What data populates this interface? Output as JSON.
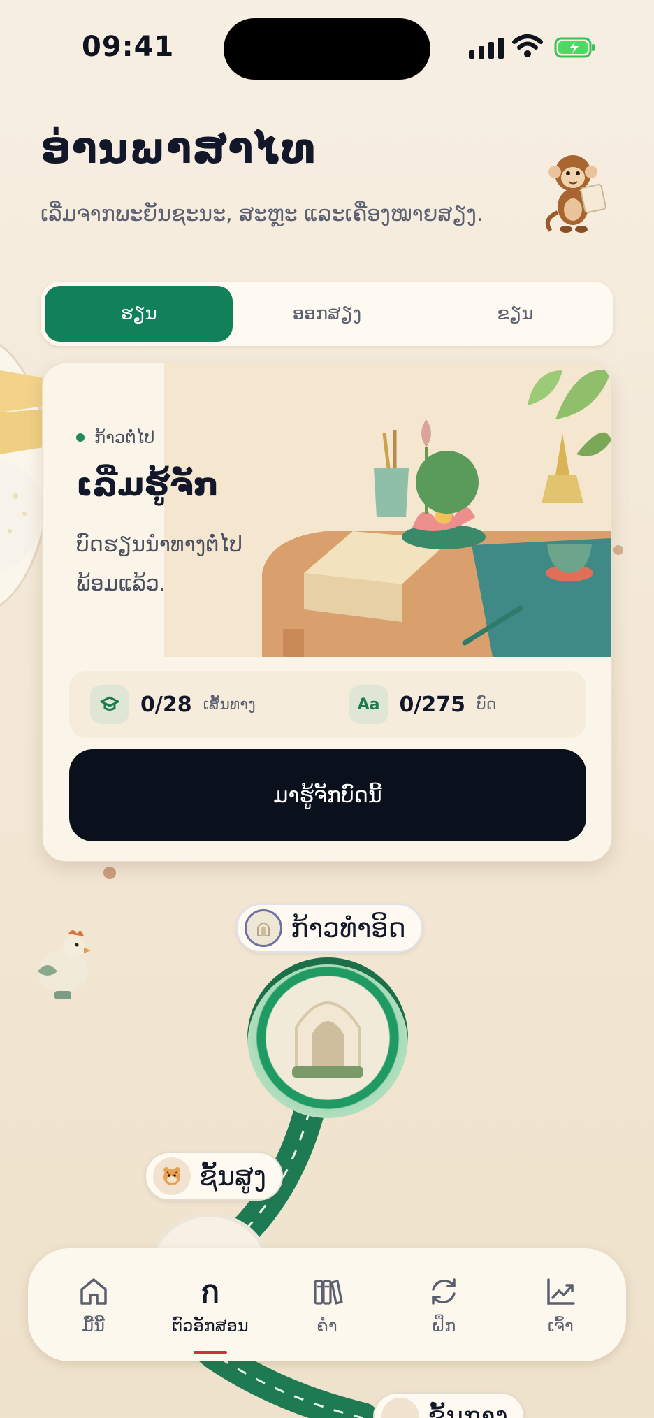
{
  "status": {
    "time": "09:41"
  },
  "header": {
    "title": "ອ່ານພາສາໄທ",
    "subtitle": "ເລີ່ມຈາກພະຍັນຊະນະ, ສະຫຼະ ແລະເຄື່ອງໝາຍສຽງ."
  },
  "segments": {
    "items": [
      "ຮຽນ",
      "ອອກສຽງ",
      "ຂຽນ"
    ],
    "selected": "ຮຽນ"
  },
  "card": {
    "badge": "ກ້າວຕໍ່ໄປ",
    "title": "ເລີ່ມຮູ້ຈັກ",
    "description": "ບົດຮຽນນຳທາງຕໍ່ໄປພ້ອມແລ້ວ.",
    "stat1_value": "0/28",
    "stat1_label": "ເສັ້ນທາງ",
    "stat2_icon": "Aa",
    "stat2_value": "0/275",
    "stat2_label": "ບົດ",
    "cta": "ມາຮູ້ຈັກບົດນີ້"
  },
  "path": {
    "node1_label": "ກ້າວທຳອິດ",
    "node2_label": "ຊັ້ນສູງ",
    "node3_label": "ຊັ້ນກາງ"
  },
  "nav": {
    "items": [
      {
        "label": "ມື້ນີ້",
        "icon": "home-icon"
      },
      {
        "label": "ຕົວອັກສອນ",
        "icon": "letter-icon",
        "glyph": "ก"
      },
      {
        "label": "ຄຳ",
        "icon": "books-icon"
      },
      {
        "label": "ຝຶກ",
        "icon": "refresh-icon"
      },
      {
        "label": "ເຈົ້າ",
        "icon": "chart-icon"
      }
    ],
    "active_index": 1
  },
  "colors": {
    "accent": "#12805a",
    "cta": "#0b111c",
    "active_underline": "#d2303b"
  }
}
